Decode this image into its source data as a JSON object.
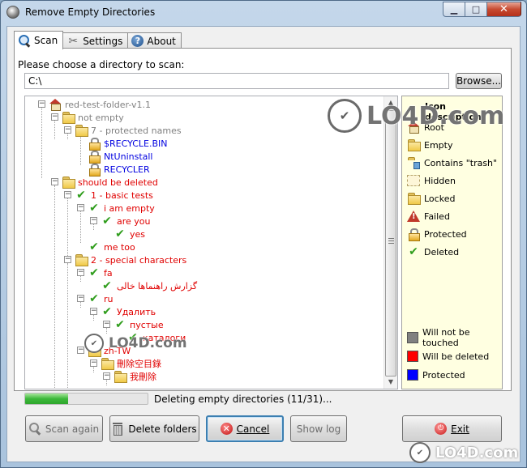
{
  "window": {
    "title": "Remove Empty Directories"
  },
  "tabs": [
    {
      "label": "Scan",
      "icon": "search-icon"
    },
    {
      "label": "Settings",
      "icon": "tools-icon"
    },
    {
      "label": "About",
      "icon": "help-icon"
    }
  ],
  "scan": {
    "prompt": "Please choose a directory to scan:",
    "path_value": "C:\\",
    "browse_label": "Browse..."
  },
  "tree": {
    "nodes": [
      {
        "label": "red-test-folder-v1.1",
        "color": "gray",
        "icon": "root"
      },
      {
        "label": "not empty",
        "color": "gray",
        "icon": "folder"
      },
      {
        "label": "7 - protected names",
        "color": "gray",
        "icon": "folder"
      },
      {
        "label": "$RECYCLE.BIN",
        "color": "blue",
        "icon": "lock"
      },
      {
        "label": "NtUninstall",
        "color": "blue",
        "icon": "lock"
      },
      {
        "label": "RECYCLER",
        "color": "blue",
        "icon": "lock"
      },
      {
        "label": "should be deleted",
        "color": "red",
        "icon": "folder"
      },
      {
        "label": "1 - basic tests",
        "color": "red",
        "icon": "check"
      },
      {
        "label": "i am empty",
        "color": "red",
        "icon": "check"
      },
      {
        "label": "are you",
        "color": "red",
        "icon": "check"
      },
      {
        "label": "yes",
        "color": "red",
        "icon": "check"
      },
      {
        "label": "me too",
        "color": "red",
        "icon": "check"
      },
      {
        "label": "2 - special characters",
        "color": "red",
        "icon": "folder"
      },
      {
        "label": "fa",
        "color": "red",
        "icon": "check"
      },
      {
        "label": "گزارش راهنماها خالی",
        "color": "red",
        "icon": "check"
      },
      {
        "label": "ru",
        "color": "red",
        "icon": "check"
      },
      {
        "label": "Удалить",
        "color": "red",
        "icon": "check"
      },
      {
        "label": "пустые",
        "color": "red",
        "icon": "check"
      },
      {
        "label": "каталоги",
        "color": "red",
        "icon": "check"
      },
      {
        "label": "zh-TW",
        "color": "red",
        "icon": "folder"
      },
      {
        "label": "刪除空目錄",
        "color": "red",
        "icon": "folder"
      },
      {
        "label": "我刪除",
        "color": "red",
        "icon": "folder"
      }
    ]
  },
  "legend": {
    "title": "Icon description",
    "icon_items": [
      {
        "label": "Root",
        "icon": "root-icon"
      },
      {
        "label": "Empty",
        "icon": "folder-icon"
      },
      {
        "label": "Contains \"trash\"",
        "icon": "trash-folder-icon"
      },
      {
        "label": "Hidden",
        "icon": "hidden-folder-icon"
      },
      {
        "label": "Locked",
        "icon": "lock-icon"
      },
      {
        "label": "Failed",
        "icon": "warning-icon"
      },
      {
        "label": "Protected",
        "icon": "lock-icon"
      },
      {
        "label": "Deleted",
        "icon": "check-icon"
      }
    ],
    "color_items": [
      {
        "label": "Will not be touched",
        "color": "#808080"
      },
      {
        "label": "Will be deleted",
        "color": "#ff0000"
      },
      {
        "label": "Protected",
        "color": "#0000ff"
      }
    ]
  },
  "progress": {
    "value": 0.35,
    "text": "Deleting empty directories (11/31)..."
  },
  "buttons": {
    "scan_again": "Scan again",
    "delete_folders": "Delete folders",
    "cancel": "Cancel",
    "show_log": "Show log",
    "exit": "Exit"
  },
  "colors": {
    "gray": "#808080",
    "red": "#e00000",
    "blue": "#0000e0",
    "legend_bg": "#ffffe1",
    "progress_green": "#3cb83a"
  },
  "watermark": {
    "text": "LO4D.com"
  }
}
